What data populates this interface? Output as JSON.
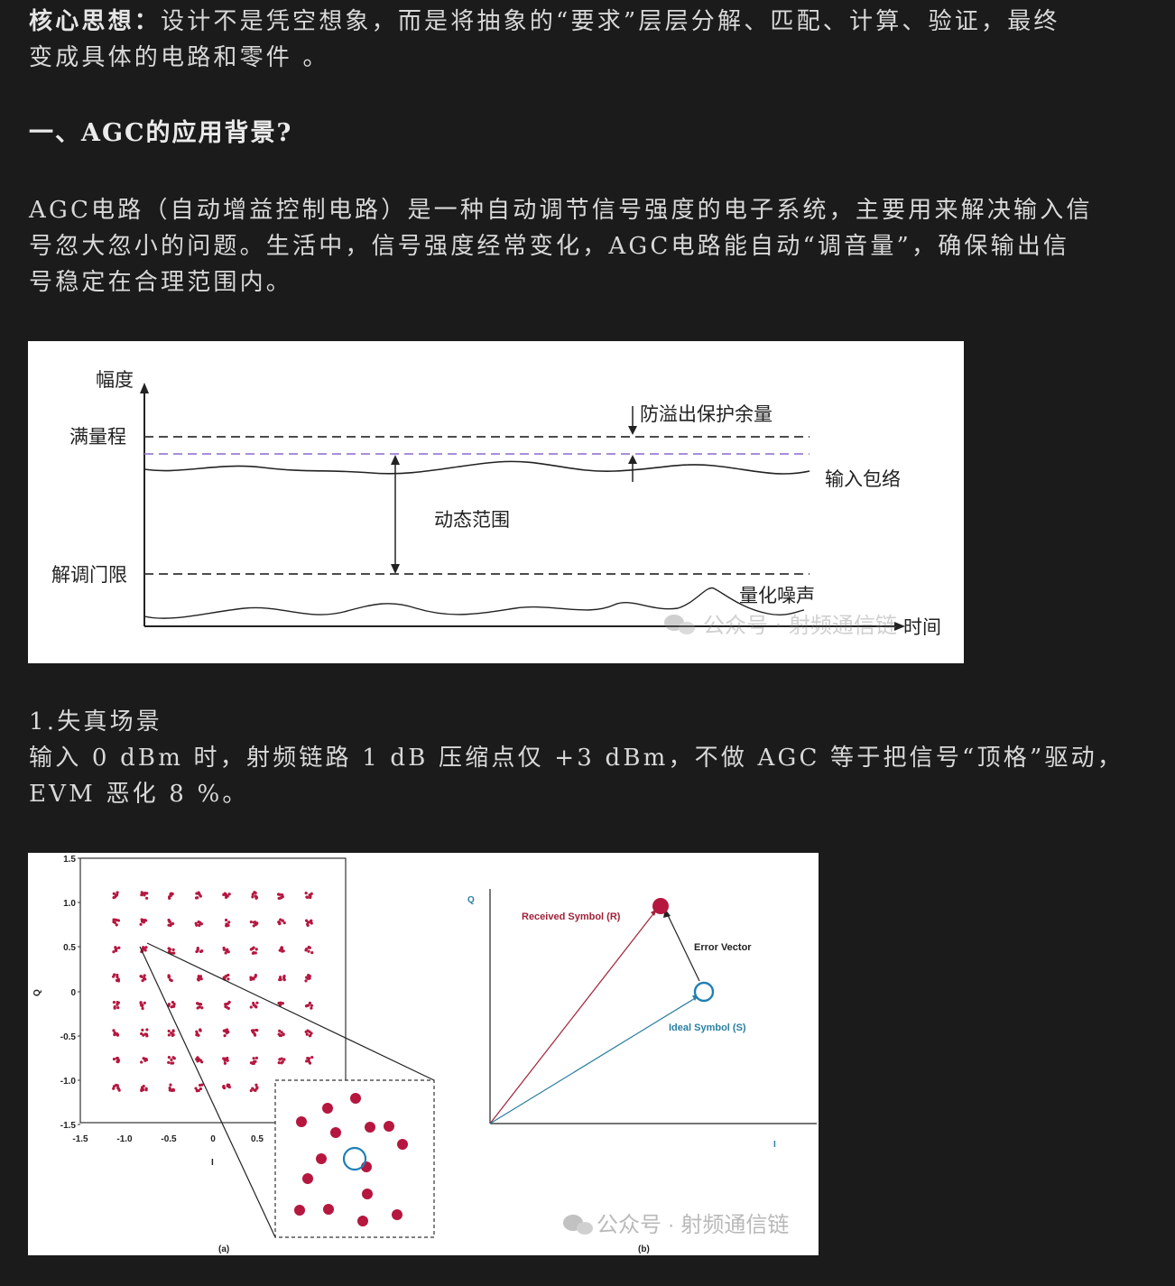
{
  "core_label": "核心思想：",
  "core_line1": "设计不是凭空想象，而是将抽象的“要求”层层分解、匹配、计算、验证，最终",
  "core_line2": "变成具体的电路和零件 。",
  "section1_heading": "一、AGC的应用背景?",
  "intro_line1": "AGC电路（自动增益控制电路）是一种自动调节信号强度的电子系统，主要用来解决输入信",
  "intro_line2": "号忽大忽小的问题。生活中，信号强度经常变化，AGC电路能自动“调音量”，确保输出信",
  "intro_line3": "号稳定在合理范围内。",
  "figure1": {
    "y_axis_label": "幅度",
    "x_axis_label": "时间",
    "full_scale_label": "满量程",
    "demod_threshold_label": "解调门限",
    "headroom_label": "防溢出保护余量",
    "input_envelope_label": "输入包络",
    "dynamic_range_label": "动态范围",
    "quant_noise_label": "量化噪声",
    "watermark": "公众号 · 射频通信链",
    "colors": {
      "dashed": "#333333",
      "headroom_dashed": "#9b7fd4",
      "curve": "#222222"
    }
  },
  "scenario_title": "1.失真场景",
  "scenario_line1": "输入 0 dBm 时，射频链路 1 dB 压缩点仅 +3 dBm，不做 AGC 等于把信号“顶格”驱动，",
  "scenario_line2": "EVM 恶化 8 %。",
  "figure2": {
    "panel_a_label": "(a)",
    "panel_b_label": "(b)",
    "a_y_label": "Q",
    "a_x_label": "I",
    "a_y_ticks": [
      "1.5",
      "1.0",
      "0.5",
      "0",
      "-0.5",
      "-1.0",
      "-1.5"
    ],
    "a_x_ticks": [
      "-1.5",
      "-1.0",
      "-0.5",
      "0",
      "0.5"
    ],
    "b_y_label": "Q",
    "b_x_label": "I",
    "received_label": "Received Symbol (R)",
    "error_label": "Error Vector",
    "ideal_label": "Ideal Symbol (S)",
    "watermark": "公众号 · 射频通信链",
    "colors": {
      "symbol": "#b5173f",
      "received_vec": "#a0223a",
      "ideal_vec": "#2a7fa0",
      "ideal_circle": "#1f7fb5"
    }
  }
}
